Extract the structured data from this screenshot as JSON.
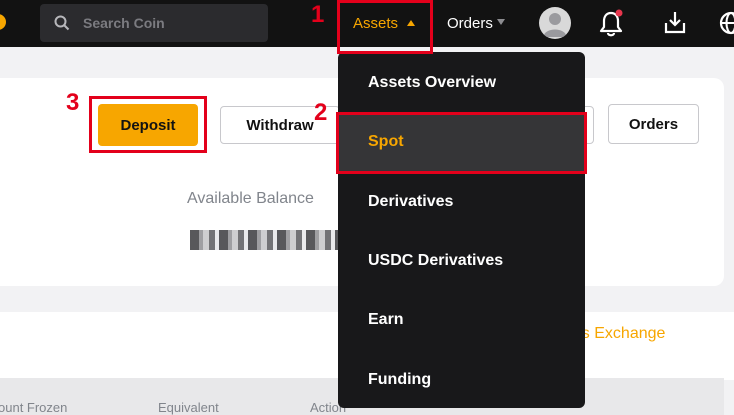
{
  "topbar": {
    "search_placeholder": "Search Coin",
    "assets_label": "Assets",
    "orders_label": "Orders",
    "icons": [
      "search-icon",
      "avatar",
      "bell-icon",
      "download-icon",
      "globe-icon"
    ]
  },
  "annotations": {
    "step1": "1",
    "step2": "2",
    "step3": "3"
  },
  "assets_menu": {
    "items": [
      {
        "label": "Assets Overview"
      },
      {
        "label": "Spot"
      },
      {
        "label": "Derivatives"
      },
      {
        "label": "USDC Derivatives"
      },
      {
        "label": "Earn"
      },
      {
        "label": "Funding"
      }
    ],
    "active_index": 1
  },
  "account_card": {
    "deposit_label": "Deposit",
    "withdraw_label": "Withdraw",
    "orders_label": "Orders",
    "available_balance_label": "Available Balance"
  },
  "section": {
    "exchange_link": "nces Exchange"
  },
  "table": {
    "headers": [
      "ount Frozen",
      "Equivalent",
      "Action"
    ]
  },
  "colors": {
    "brand": "#f7a600",
    "topbar": "#121212",
    "menu_bg": "#18181a",
    "menu_active": "#353537",
    "annotation_red": "#e3001b"
  }
}
